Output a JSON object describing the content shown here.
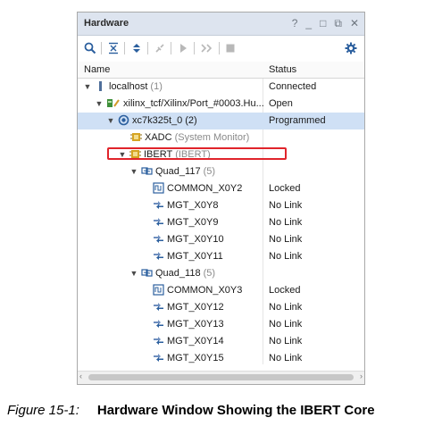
{
  "window": {
    "title": "Hardware",
    "controls": [
      "?",
      "_",
      "□",
      "⧉",
      "✕"
    ]
  },
  "toolbar": {
    "icons": [
      "search-icon",
      "collapse-all-icon",
      "expand-all-icon",
      "connect-icon",
      "run-icon",
      "forward-icon",
      "stop-icon",
      "gear-icon"
    ]
  },
  "columns": {
    "name": "Name",
    "status": "Status"
  },
  "tree": [
    {
      "label": "localhost",
      "suffix": "(1)",
      "status": "Connected"
    },
    {
      "label": "xilinx_tcf/Xilinx/Port_#0003.Hu...",
      "suffix": "",
      "status": "Open"
    },
    {
      "label": "xc7k325t_0",
      "suffix": "(2)",
      "status": "Programmed"
    },
    {
      "label": "XADC",
      "suffix": "(System Monitor)",
      "status": ""
    },
    {
      "label": "IBERT",
      "suffix": "(IBERT)",
      "status": ""
    },
    {
      "label": "Quad_117",
      "suffix": "(5)",
      "status": ""
    },
    {
      "label": "COMMON_X0Y2",
      "suffix": "",
      "status": "Locked"
    },
    {
      "label": "MGT_X0Y8",
      "suffix": "",
      "status": "No Link"
    },
    {
      "label": "MGT_X0Y9",
      "suffix": "",
      "status": "No Link"
    },
    {
      "label": "MGT_X0Y10",
      "suffix": "",
      "status": "No Link"
    },
    {
      "label": "MGT_X0Y11",
      "suffix": "",
      "status": "No Link"
    },
    {
      "label": "Quad_118",
      "suffix": "(5)",
      "status": ""
    },
    {
      "label": "COMMON_X0Y3",
      "suffix": "",
      "status": "Locked"
    },
    {
      "label": "MGT_X0Y12",
      "suffix": "",
      "status": "No Link"
    },
    {
      "label": "MGT_X0Y13",
      "suffix": "",
      "status": "No Link"
    },
    {
      "label": "MGT_X0Y14",
      "suffix": "",
      "status": "No Link"
    },
    {
      "label": "MGT_X0Y15",
      "suffix": "",
      "status": "No Link"
    }
  ],
  "caption": {
    "figure": "Figure 15-1:",
    "text": "Hardware Window Showing the IBERT Core"
  },
  "colors": {
    "selection": "#cfe0f5",
    "highlight": "#e0242b",
    "titlebar": "#dde4ef"
  }
}
